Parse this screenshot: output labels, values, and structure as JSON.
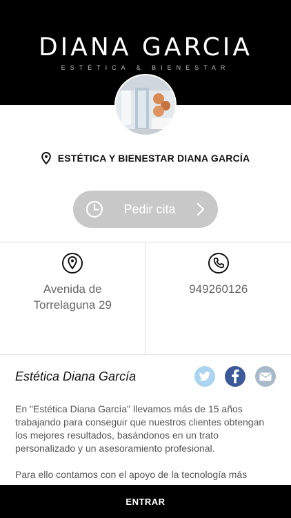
{
  "header": {
    "brand_name": "DIANA GARCIA",
    "brand_tagline": "ESTÉTICA & BIENESTAR"
  },
  "business": {
    "name": "ESTÉTICA Y BIENESTAR DIANA GARCÍA"
  },
  "appointment": {
    "label": "Pedir cita"
  },
  "contact": {
    "address_line1": "Avenida de",
    "address_line2": "Torrelaguna 29",
    "phone": "949260126"
  },
  "about": {
    "title": "Estética Diana García",
    "paragraph1": "En \"Estética Diana García\" llevamos más de 15 años trabajando para conseguir que nuestros clientes obtengan los mejores resultados, basándonos en un trato personalizado y un asesoramiento profesional.",
    "paragraph2": "Para ello contamos con el apoyo de la tecnología más"
  },
  "social": {
    "icons": [
      "twitter-icon",
      "facebook-icon",
      "mail-icon"
    ]
  },
  "footer": {
    "enter_label": "ENTRAR"
  },
  "colors": {
    "header_bg": "#000000",
    "button_bg": "#c8c8c8",
    "twitter": "#aad4ef",
    "facebook": "#3b5998",
    "mail": "#a8b9c9"
  }
}
